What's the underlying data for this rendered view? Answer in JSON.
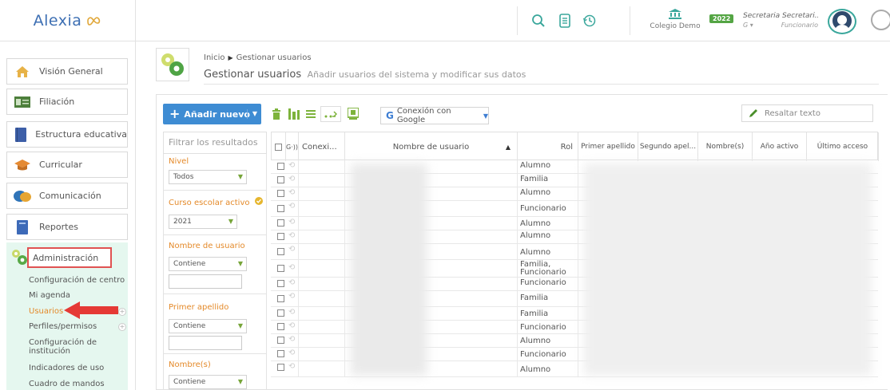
{
  "header": {
    "logo_text": "Alexia",
    "school_name": "Colegio Demo",
    "year_badge": "2022",
    "user_name": "Secretaria Secretari...",
    "user_role": "Funcionario",
    "user_g": "G",
    "colors": {
      "accent": "#3e8cd3",
      "badge": "#54a544",
      "avatar_ring": "#3aa79c"
    }
  },
  "sidebar": {
    "items": [
      {
        "label": "Visión General",
        "icon": "home-icon"
      },
      {
        "label": "Filiación",
        "icon": "id-card-icon"
      },
      {
        "label": "Estructura educativa",
        "icon": "book-icon"
      },
      {
        "label": "Curricular",
        "icon": "graduation-cap-icon"
      },
      {
        "label": "Comunicación",
        "icon": "chat-icon"
      },
      {
        "label": "Reportes",
        "icon": "report-icon"
      }
    ],
    "admin": {
      "label": "Administración",
      "icon": "gears-icon",
      "sub_items": [
        {
          "label": "Configuración de centro"
        },
        {
          "label": "Mi agenda"
        },
        {
          "label": "Usuarios",
          "active": true
        },
        {
          "label": "Perfiles/permisos"
        },
        {
          "label": "Configuración de",
          "label2": "institución"
        },
        {
          "label": "Indicadores de uso"
        },
        {
          "label": "Cuadro de mandos"
        }
      ]
    }
  },
  "breadcrumb": {
    "home": "Inicio",
    "current": "Gestionar usuarios",
    "title": "Gestionar usuarios",
    "subtitle": "Añadir usuarios del sistema y modificar sus datos"
  },
  "toolbar": {
    "add_label": "Añadir nuevo",
    "google_label": "Conexión con Google",
    "google_letter": "G",
    "highlight_label": "Resaltar texto"
  },
  "filters": {
    "title": "Filtrar los resultados",
    "nivel_label": "Nivel",
    "nivel_value": "Todos",
    "curso_label": "Curso escolar activo",
    "curso_value": "2021",
    "username_label": "Nombre de usuario",
    "username_op": "Contiene",
    "apellido_label": "Primer apellido",
    "apellido_op": "Contiene",
    "nombres_label": "Nombre(s)",
    "nombres_op": "Contiene"
  },
  "table": {
    "columns": {
      "google": "G·))",
      "conexion": "Conexi...",
      "username": "Nombre de usuario",
      "rol": "Rol",
      "primer_apellido": "Primer apellido",
      "segundo_apellido": "Segundo apel...",
      "nombres": "Nombre(s)",
      "anio": "Año activo",
      "ultimo": "Último acceso"
    },
    "rows": [
      {
        "rol": "Alumno"
      },
      {
        "rol": "Familia"
      },
      {
        "rol": "Alumno"
      },
      {
        "rol": "Funcionario"
      },
      {
        "rol": "Alumno"
      },
      {
        "rol": "Alumno"
      },
      {
        "rol": "Alumno"
      },
      {
        "rol": "Familia,",
        "rol2": "Funcionario"
      },
      {
        "rol": "Funcionario"
      },
      {
        "rol": "Familia"
      },
      {
        "rol": "Familia"
      },
      {
        "rol": "Funcionario"
      },
      {
        "rol": "Alumno"
      },
      {
        "rol": "Funcionario"
      },
      {
        "rol": "Alumno"
      }
    ]
  }
}
